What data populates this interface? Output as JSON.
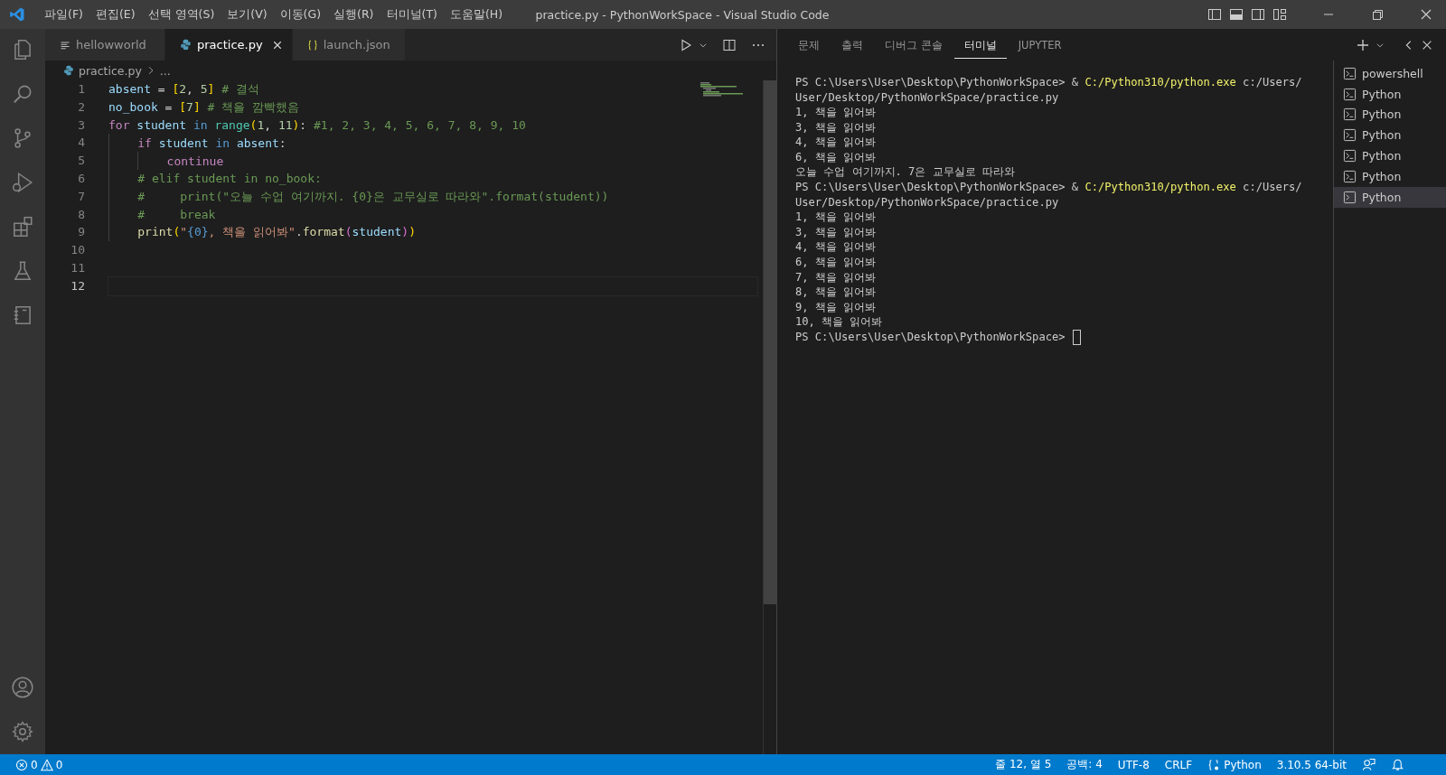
{
  "title_bar": {
    "menu": [
      "파일(F)",
      "편집(E)",
      "선택 영역(S)",
      "보기(V)",
      "이동(G)",
      "실행(R)",
      "터미널(T)",
      "도움말(H)"
    ],
    "title": "practice.py - PythonWorkSpace - Visual Studio Code"
  },
  "editor": {
    "tabs": [
      {
        "label": "hellowworld",
        "kind": "text",
        "selected": false
      },
      {
        "label": "practice.py",
        "kind": "python",
        "selected": true
      },
      {
        "label": "launch.json",
        "kind": "json",
        "selected": false
      }
    ],
    "breadcrumb": {
      "file": "practice.py",
      "more": "..."
    },
    "lines": [
      {
        "number": "1",
        "selected": false,
        "tokens": [
          {
            "text": "absent",
            "kind": "var"
          },
          {
            "text": " = ",
            "kind": "op"
          },
          {
            "text": "[",
            "kind": "bracket1"
          },
          {
            "text": "2",
            "kind": "num"
          },
          {
            "text": ", ",
            "kind": "op"
          },
          {
            "text": "5",
            "kind": "num"
          },
          {
            "text": "]",
            "kind": "bracket1"
          },
          {
            "text": " # 결석",
            "kind": "comment"
          }
        ]
      },
      {
        "number": "2",
        "selected": false,
        "tokens": [
          {
            "text": "no_book",
            "kind": "var"
          },
          {
            "text": " = ",
            "kind": "op"
          },
          {
            "text": "[",
            "kind": "bracket1"
          },
          {
            "text": "7",
            "kind": "num"
          },
          {
            "text": "]",
            "kind": "bracket1"
          },
          {
            "text": " # 책을 깜빡했음",
            "kind": "comment"
          }
        ]
      },
      {
        "number": "3",
        "selected": false,
        "tokens": [
          {
            "text": "for",
            "kind": "keyword"
          },
          {
            "text": " student",
            "kind": "var"
          },
          {
            "text": " in",
            "kind": "keyword2"
          },
          {
            "text": " range",
            "kind": "builtin"
          },
          {
            "text": "(",
            "kind": "bracket1"
          },
          {
            "text": "1",
            "kind": "num"
          },
          {
            "text": ", ",
            "kind": "op"
          },
          {
            "text": "11",
            "kind": "num"
          },
          {
            "text": ")",
            "kind": "bracket1"
          },
          {
            "text": ": ",
            "kind": "op"
          },
          {
            "text": "#1, 2, 3, 4, 5, 6, 7, 8, 9, 10",
            "kind": "comment"
          }
        ]
      },
      {
        "number": "4",
        "selected": false,
        "tokens": [
          {
            "text": "    if",
            "kind": "keyword"
          },
          {
            "text": " student",
            "kind": "var"
          },
          {
            "text": " in",
            "kind": "keyword2"
          },
          {
            "text": " absent",
            "kind": "var"
          },
          {
            "text": ":",
            "kind": "op"
          }
        ]
      },
      {
        "number": "5",
        "selected": false,
        "tokens": [
          {
            "text": "        continue",
            "kind": "keyword"
          }
        ]
      },
      {
        "number": "6",
        "selected": false,
        "tokens": [
          {
            "text": "    # elif student in no_book:",
            "kind": "comment"
          }
        ]
      },
      {
        "number": "7",
        "selected": false,
        "tokens": [
          {
            "text": "    #     print(\"오늘 수업 여기까지. {0}은 교무실로 따라와\".format(student))",
            "kind": "comment"
          }
        ]
      },
      {
        "number": "8",
        "selected": false,
        "tokens": [
          {
            "text": "    #     break",
            "kind": "comment"
          }
        ]
      },
      {
        "number": "9",
        "selected": false,
        "tokens": [
          {
            "text": "    print",
            "kind": "func"
          },
          {
            "text": "(",
            "kind": "bracket1"
          },
          {
            "text": "\"",
            "kind": "string"
          },
          {
            "text": "{0}",
            "kind": "placeholder"
          },
          {
            "text": ", 책을 읽어봐\"",
            "kind": "string"
          },
          {
            "text": ".",
            "kind": "op"
          },
          {
            "text": "format",
            "kind": "func"
          },
          {
            "text": "(",
            "kind": "bracket2"
          },
          {
            "text": "student",
            "kind": "var"
          },
          {
            "text": ")",
            "kind": "bracket2"
          },
          {
            "text": ")",
            "kind": "bracket1"
          }
        ]
      },
      {
        "number": "10",
        "selected": false
      },
      {
        "number": "11",
        "selected": false
      },
      {
        "number": "12",
        "selected": true
      }
    ]
  },
  "panel": {
    "tabs": [
      {
        "label": "문제",
        "selected": false
      },
      {
        "label": "출력",
        "selected": false
      },
      {
        "label": "디버그 콘솔",
        "selected": false
      },
      {
        "label": "터미널",
        "selected": true
      },
      {
        "label": "JUPYTER",
        "selected": false
      }
    ],
    "terminal": {
      "cursor": true,
      "lines": [
        [
          {
            "text": "PS C:\\Users\\User\\Desktop\\PythonWorkSpace> & ",
            "kind": "plain"
          },
          {
            "text": "C:/Python310/python.exe",
            "kind": "command"
          },
          {
            "text": " c:/Users/",
            "kind": "plain"
          }
        ],
        [
          {
            "text": "User/Desktop/PythonWorkSpace/practice.py",
            "kind": "plain"
          }
        ],
        [
          {
            "text": "1, 책을 읽어봐",
            "kind": "plain"
          }
        ],
        [
          {
            "text": "3, 책을 읽어봐",
            "kind": "plain"
          }
        ],
        [
          {
            "text": "4, 책을 읽어봐",
            "kind": "plain"
          }
        ],
        [
          {
            "text": "6, 책을 읽어봐",
            "kind": "plain"
          }
        ],
        [
          {
            "text": "오늘 수업 여기까지. 7은 교무실로 따라와",
            "kind": "plain"
          }
        ],
        [
          {
            "text": "PS C:\\Users\\User\\Desktop\\PythonWorkSpace> & ",
            "kind": "plain"
          },
          {
            "text": "C:/Python310/python.exe",
            "kind": "command"
          },
          {
            "text": " c:/Users/",
            "kind": "plain"
          }
        ],
        [
          {
            "text": "User/Desktop/PythonWorkSpace/practice.py",
            "kind": "plain"
          }
        ],
        [
          {
            "text": "1, 책을 읽어봐",
            "kind": "plain"
          }
        ],
        [
          {
            "text": "3, 책을 읽어봐",
            "kind": "plain"
          }
        ],
        [
          {
            "text": "4, 책을 읽어봐",
            "kind": "plain"
          }
        ],
        [
          {
            "text": "6, 책을 읽어봐",
            "kind": "plain"
          }
        ],
        [
          {
            "text": "7, 책을 읽어봐",
            "kind": "plain"
          }
        ],
        [
          {
            "text": "8, 책을 읽어봐",
            "kind": "plain"
          }
        ],
        [
          {
            "text": "9, 책을 읽어봐",
            "kind": "plain"
          }
        ],
        [
          {
            "text": "10, 책을 읽어봐",
            "kind": "plain"
          }
        ],
        [
          {
            "text": "PS C:\\Users\\User\\Desktop\\PythonWorkSpace>",
            "kind": "plain"
          }
        ]
      ]
    },
    "terminals": [
      {
        "label": "powershell",
        "selected": false
      },
      {
        "label": "Python",
        "selected": false
      },
      {
        "label": "Python",
        "selected": false
      },
      {
        "label": "Python",
        "selected": false
      },
      {
        "label": "Python",
        "selected": false
      },
      {
        "label": "Python",
        "selected": false
      },
      {
        "label": "Python",
        "selected": true
      }
    ]
  },
  "status_bar": {
    "errors": "0",
    "warnings": "0",
    "items": [
      {
        "text": "줄 12, 열 5",
        "kind": "text"
      },
      {
        "text": "공백: 4",
        "kind": "text"
      },
      {
        "text": "UTF-8",
        "kind": "text"
      },
      {
        "text": "CRLF",
        "kind": "text"
      },
      {
        "text": "Python",
        "kind": "language"
      },
      {
        "text": "3.10.5 64-bit",
        "kind": "text"
      }
    ]
  }
}
